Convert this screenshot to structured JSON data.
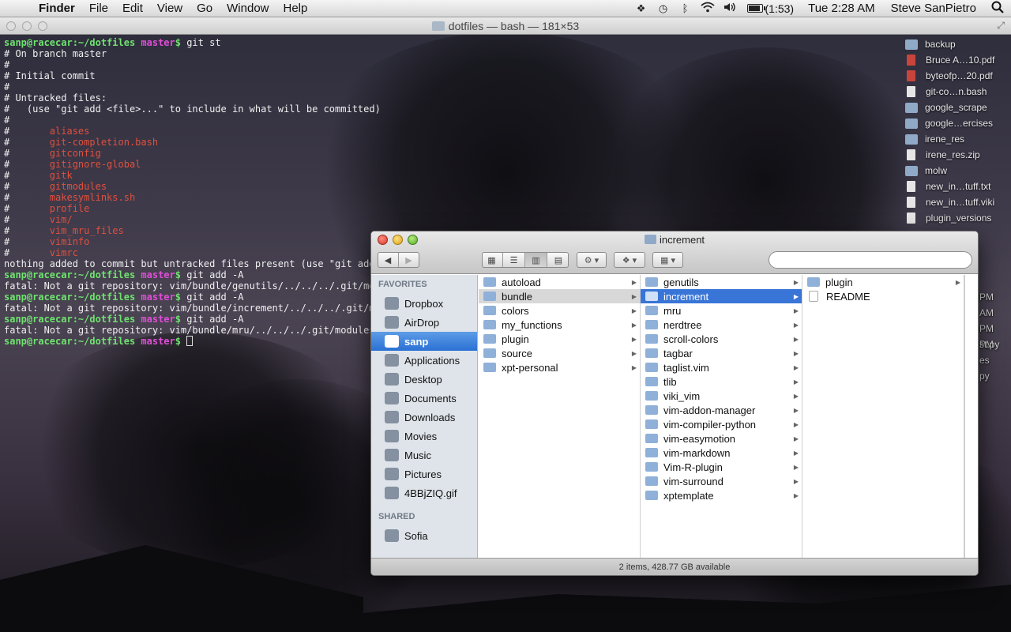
{
  "menubar": {
    "app_name": "Finder",
    "menus": [
      "File",
      "Edit",
      "View",
      "Go",
      "Window",
      "Help"
    ],
    "battery_text": "(1:53)",
    "battery_level": 0.85,
    "clock": "Tue 2:28 AM",
    "user": "Steve SanPietro",
    "status_icons": [
      "dropbox-icon",
      "time-machine-icon",
      "bluetooth-icon",
      "wifi-icon",
      "volume-icon",
      "battery-icon",
      "spotlight-icon"
    ]
  },
  "terminal": {
    "title": "dotfiles — bash — 181×53",
    "lines": [
      [
        {
          "t": "sanp@racecar:~/dotfiles ",
          "c": "green"
        },
        {
          "t": "master",
          "c": "pink"
        },
        {
          "t": "$ ",
          "c": "green"
        },
        {
          "t": "git st",
          "c": ""
        }
      ],
      [
        {
          "t": "# On branch master",
          "c": ""
        }
      ],
      [
        {
          "t": "#",
          "c": ""
        }
      ],
      [
        {
          "t": "# Initial commit",
          "c": ""
        }
      ],
      [
        {
          "t": "#",
          "c": ""
        }
      ],
      [
        {
          "t": "# Untracked files:",
          "c": ""
        }
      ],
      [
        {
          "t": "#   (use \"git add <file>...\" to include in what will be committed)",
          "c": ""
        }
      ],
      [
        {
          "t": "#",
          "c": ""
        }
      ],
      [
        {
          "t": "#\t",
          "c": ""
        },
        {
          "t": "aliases",
          "c": "red"
        }
      ],
      [
        {
          "t": "#\t",
          "c": ""
        },
        {
          "t": "git-completion.bash",
          "c": "red"
        }
      ],
      [
        {
          "t": "#\t",
          "c": ""
        },
        {
          "t": "gitconfig",
          "c": "red"
        }
      ],
      [
        {
          "t": "#\t",
          "c": ""
        },
        {
          "t": "gitignore-global",
          "c": "red"
        }
      ],
      [
        {
          "t": "#\t",
          "c": ""
        },
        {
          "t": "gitk",
          "c": "red"
        }
      ],
      [
        {
          "t": "#\t",
          "c": ""
        },
        {
          "t": "gitmodules",
          "c": "red"
        }
      ],
      [
        {
          "t": "#\t",
          "c": ""
        },
        {
          "t": "makesymlinks.sh",
          "c": "red"
        }
      ],
      [
        {
          "t": "#\t",
          "c": ""
        },
        {
          "t": "profile",
          "c": "red"
        }
      ],
      [
        {
          "t": "#\t",
          "c": ""
        },
        {
          "t": "vim/",
          "c": "red"
        }
      ],
      [
        {
          "t": "#\t",
          "c": ""
        },
        {
          "t": "vim_mru_files",
          "c": "red"
        }
      ],
      [
        {
          "t": "#\t",
          "c": ""
        },
        {
          "t": "viminfo",
          "c": "red"
        }
      ],
      [
        {
          "t": "#\t",
          "c": ""
        },
        {
          "t": "vimrc",
          "c": "red"
        }
      ],
      [
        {
          "t": "nothing added to commit but untracked files present (use \"git add\"",
          "c": ""
        }
      ],
      [
        {
          "t": "sanp@racecar:~/dotfiles ",
          "c": "green"
        },
        {
          "t": "master",
          "c": "pink"
        },
        {
          "t": "$ ",
          "c": "green"
        },
        {
          "t": "git add -A",
          "c": ""
        }
      ],
      [
        {
          "t": "fatal: Not a git repository: vim/bundle/genutils/../../../.git/mod",
          "c": ""
        }
      ],
      [
        {
          "t": "sanp@racecar:~/dotfiles ",
          "c": "green"
        },
        {
          "t": "master",
          "c": "pink"
        },
        {
          "t": "$ ",
          "c": "green"
        },
        {
          "t": "git add -A",
          "c": ""
        }
      ],
      [
        {
          "t": "fatal: Not a git repository: vim/bundle/increment/../../../.git/mo",
          "c": ""
        }
      ],
      [
        {
          "t": "sanp@racecar:~/dotfiles ",
          "c": "green"
        },
        {
          "t": "master",
          "c": "pink"
        },
        {
          "t": "$ ",
          "c": "green"
        },
        {
          "t": "git add -A",
          "c": ""
        }
      ],
      [
        {
          "t": "fatal: Not a git repository: vim/bundle/mru/../../../.git/modules/",
          "c": ""
        }
      ],
      [
        {
          "t": "sanp@racecar:~/dotfiles ",
          "c": "green"
        },
        {
          "t": "master",
          "c": "pink"
        },
        {
          "t": "$ ",
          "c": "green"
        }
      ]
    ]
  },
  "desktop_icons": [
    {
      "label": "backup",
      "kind": "folder"
    },
    {
      "label": "Bruce A…10.pdf",
      "kind": "pdf"
    },
    {
      "label": "byteofp…20.pdf",
      "kind": "pdf"
    },
    {
      "label": "git-co…n.bash",
      "kind": "doc"
    },
    {
      "label": "google_scrape",
      "kind": "folder"
    },
    {
      "label": "google…ercises",
      "kind": "folder"
    },
    {
      "label": "irene_res",
      "kind": "folder"
    },
    {
      "label": "irene_res.zip",
      "kind": "doc"
    },
    {
      "label": "molw",
      "kind": "folder"
    },
    {
      "label": "new_in…tuff.txt",
      "kind": "doc"
    },
    {
      "label": "new_in…tuff.viki",
      "kind": "doc"
    },
    {
      "label": "plugin_versions",
      "kind": "doc"
    }
  ],
  "desktop_fragments": [
    "PM",
    "AM",
    "PM",
    "PM",
    "st.py",
    "es",
    "py"
  ],
  "finder": {
    "title": "increment",
    "search_placeholder": "",
    "sidebar": {
      "favorites_header": "FAVORITES",
      "favorites": [
        {
          "label": "Dropbox",
          "icon": "dropbox-icon",
          "selected": false
        },
        {
          "label": "AirDrop",
          "icon": "airdrop-icon",
          "selected": false
        },
        {
          "label": "sanp",
          "icon": "home-icon",
          "selected": true
        },
        {
          "label": "Applications",
          "icon": "applications-icon",
          "selected": false
        },
        {
          "label": "Desktop",
          "icon": "desktop-icon",
          "selected": false
        },
        {
          "label": "Documents",
          "icon": "documents-icon",
          "selected": false
        },
        {
          "label": "Downloads",
          "icon": "downloads-icon",
          "selected": false
        },
        {
          "label": "Movies",
          "icon": "movies-icon",
          "selected": false
        },
        {
          "label": "Music",
          "icon": "music-icon",
          "selected": false
        },
        {
          "label": "Pictures",
          "icon": "pictures-icon",
          "selected": false
        },
        {
          "label": "4BBjZIQ.gif",
          "icon": "file-icon",
          "selected": false
        }
      ],
      "shared_header": "SHARED",
      "shared": [
        {
          "label": "Sofia",
          "icon": "computer-icon",
          "selected": false
        }
      ]
    },
    "columns": [
      {
        "items": [
          {
            "label": "autoload",
            "kind": "folder",
            "state": ""
          },
          {
            "label": "bundle",
            "kind": "folder",
            "state": "grey"
          },
          {
            "label": "colors",
            "kind": "folder",
            "state": ""
          },
          {
            "label": "my_functions",
            "kind": "folder",
            "state": ""
          },
          {
            "label": "plugin",
            "kind": "folder",
            "state": ""
          },
          {
            "label": "source",
            "kind": "folder",
            "state": ""
          },
          {
            "label": "xpt-personal",
            "kind": "folder",
            "state": ""
          }
        ]
      },
      {
        "items": [
          {
            "label": "genutils",
            "kind": "folder",
            "state": ""
          },
          {
            "label": "increment",
            "kind": "folder",
            "state": "blue"
          },
          {
            "label": "mru",
            "kind": "folder",
            "state": ""
          },
          {
            "label": "nerdtree",
            "kind": "folder",
            "state": ""
          },
          {
            "label": "scroll-colors",
            "kind": "folder",
            "state": ""
          },
          {
            "label": "tagbar",
            "kind": "folder",
            "state": ""
          },
          {
            "label": "taglist.vim",
            "kind": "folder",
            "state": ""
          },
          {
            "label": "tlib",
            "kind": "folder",
            "state": ""
          },
          {
            "label": "viki_vim",
            "kind": "folder",
            "state": ""
          },
          {
            "label": "vim-addon-manager",
            "kind": "folder",
            "state": ""
          },
          {
            "label": "vim-compiler-python",
            "kind": "folder",
            "state": ""
          },
          {
            "label": "vim-easymotion",
            "kind": "folder",
            "state": ""
          },
          {
            "label": "vim-markdown",
            "kind": "folder",
            "state": ""
          },
          {
            "label": "Vim-R-plugin",
            "kind": "folder",
            "state": ""
          },
          {
            "label": "vim-surround",
            "kind": "folder",
            "state": ""
          },
          {
            "label": "xptemplate",
            "kind": "folder",
            "state": ""
          }
        ]
      },
      {
        "items": [
          {
            "label": "plugin",
            "kind": "folder",
            "state": ""
          },
          {
            "label": "README",
            "kind": "doc",
            "state": ""
          }
        ]
      }
    ],
    "status": "2 items, 428.77 GB available"
  }
}
